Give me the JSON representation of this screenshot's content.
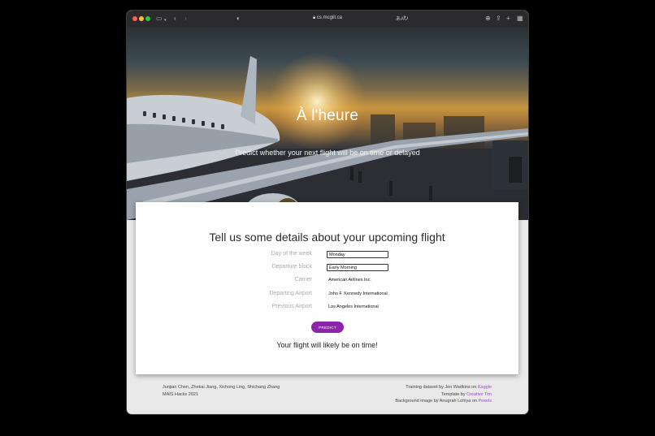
{
  "browser": {
    "url": "cs.mcgill.ca"
  },
  "hero": {
    "title": "À l'heure",
    "subtitle": "Predict whether your next flight will be on time or delayed"
  },
  "form": {
    "heading": "Tell us some details about your upcoming flight",
    "fields": [
      {
        "label": "Day of the week",
        "value": "Monday"
      },
      {
        "label": "Departure block",
        "value": "Early Morning"
      },
      {
        "label": "Carrier",
        "value": "American Airlines Inc."
      },
      {
        "label": "Departing Airport",
        "value": "John F. Kennedy International"
      },
      {
        "label": "Previous Airport",
        "value": "Los Angeles International"
      }
    ],
    "predict_label": "PREDICT",
    "result": "Your flight will likely be on time!"
  },
  "footer": {
    "authors": "Junjian Chen, Zhekai Jiang, Xichong Ling, Shichang Zhang",
    "event": "MAIS Hacks 2021",
    "dataset_text": "Training dataset by Jen Wadkins on",
    "dataset_link": "Kaggle",
    "template_text": "Template by",
    "template_link": "Creative Tim",
    "background_text": "Background image by Anugrah Lohiya on",
    "background_link": "Pexels"
  },
  "colors": {
    "accent": "#8e24aa",
    "link": "#a04bd0"
  }
}
